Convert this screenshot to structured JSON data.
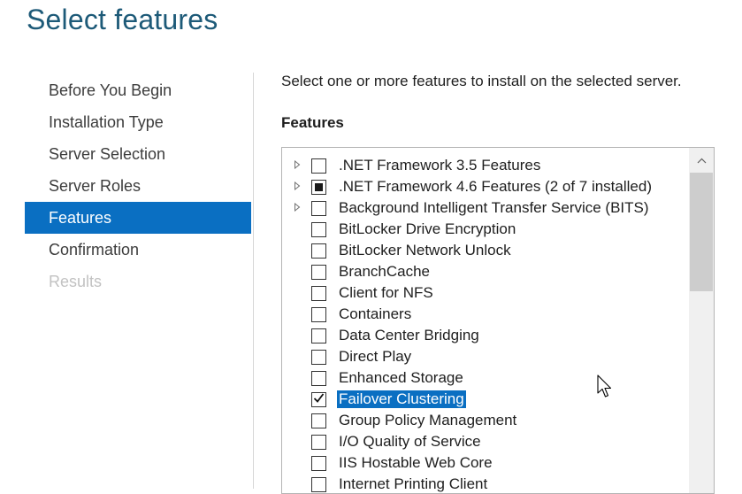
{
  "page": {
    "title": "Select features"
  },
  "nav": {
    "items": [
      {
        "label": "Before You Begin",
        "state": "normal"
      },
      {
        "label": "Installation Type",
        "state": "normal"
      },
      {
        "label": "Server Selection",
        "state": "normal"
      },
      {
        "label": "Server Roles",
        "state": "normal"
      },
      {
        "label": "Features",
        "state": "active"
      },
      {
        "label": "Confirmation",
        "state": "normal"
      },
      {
        "label": "Results",
        "state": "disabled"
      }
    ]
  },
  "main": {
    "instruction": "Select one or more features to install on the selected server.",
    "features_label": "Features",
    "features": [
      {
        "label": ".NET Framework 3.5 Features",
        "expandable": true,
        "check": "unchecked",
        "selected": false
      },
      {
        "label": ".NET Framework 4.6 Features (2 of 7 installed)",
        "expandable": true,
        "check": "partial",
        "selected": false
      },
      {
        "label": "Background Intelligent Transfer Service (BITS)",
        "expandable": true,
        "check": "unchecked",
        "selected": false
      },
      {
        "label": "BitLocker Drive Encryption",
        "expandable": false,
        "check": "unchecked",
        "selected": false
      },
      {
        "label": "BitLocker Network Unlock",
        "expandable": false,
        "check": "unchecked",
        "selected": false
      },
      {
        "label": "BranchCache",
        "expandable": false,
        "check": "unchecked",
        "selected": false
      },
      {
        "label": "Client for NFS",
        "expandable": false,
        "check": "unchecked",
        "selected": false
      },
      {
        "label": "Containers",
        "expandable": false,
        "check": "unchecked",
        "selected": false
      },
      {
        "label": "Data Center Bridging",
        "expandable": false,
        "check": "unchecked",
        "selected": false
      },
      {
        "label": "Direct Play",
        "expandable": false,
        "check": "unchecked",
        "selected": false
      },
      {
        "label": "Enhanced Storage",
        "expandable": false,
        "check": "unchecked",
        "selected": false
      },
      {
        "label": "Failover Clustering",
        "expandable": false,
        "check": "checked",
        "selected": true
      },
      {
        "label": "Group Policy Management",
        "expandable": false,
        "check": "unchecked",
        "selected": false
      },
      {
        "label": "I/O Quality of Service",
        "expandable": false,
        "check": "unchecked",
        "selected": false
      },
      {
        "label": "IIS Hostable Web Core",
        "expandable": false,
        "check": "unchecked",
        "selected": false
      },
      {
        "label": "Internet Printing Client",
        "expandable": false,
        "check": "unchecked",
        "selected": false
      }
    ]
  },
  "colors": {
    "accent": "#0a6fc2",
    "title": "#1d5a78"
  }
}
